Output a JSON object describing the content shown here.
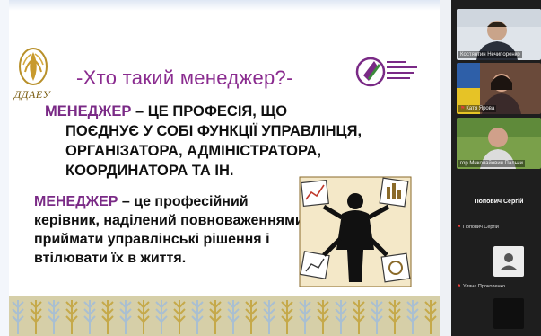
{
  "slide": {
    "title": "-Хто такий менеджер?-",
    "left_logo_text": "ДДАЕУ",
    "definition1": {
      "keyword": "МЕНЕДЖЕР",
      "line1_rest": " – ЦЕ ПРОФЕСІЯ, ЩО",
      "line2": "ПОЄДНУЄ У СОБІ  ФУНКЦІЇ УПРАВЛІНЦЯ,",
      "line3": "ОРГАНІЗАТОРА, АДМІНІСТРАТОРА,",
      "line4": "КООРДИНАТОРА ТА ІН."
    },
    "definition2": {
      "keyword": "МЕНЕДЖЕР",
      "line1_rest": " – це професійний",
      "line2": "керівник, наділений повноваженнями",
      "line3": "приймати управлінські рішення і",
      "line4": "втілювати їх в життя."
    }
  },
  "participants": {
    "tiles": [
      {
        "name": "Костянтин Нечипоренко"
      },
      {
        "name": "Катя Ярова"
      },
      {
        "name": "гор Миколайович Пальчи"
      }
    ],
    "active_speaker": "Попович Сергій",
    "mini": [
      {
        "name": "Попович Сергій",
        "has_avatar": true
      },
      {
        "name": "Уляна Прокопенко",
        "has_avatar": true
      }
    ]
  },
  "colors": {
    "title": "#8a2b8f",
    "keyword": "#7a2a86",
    "mic_muted": "#e0403b"
  }
}
